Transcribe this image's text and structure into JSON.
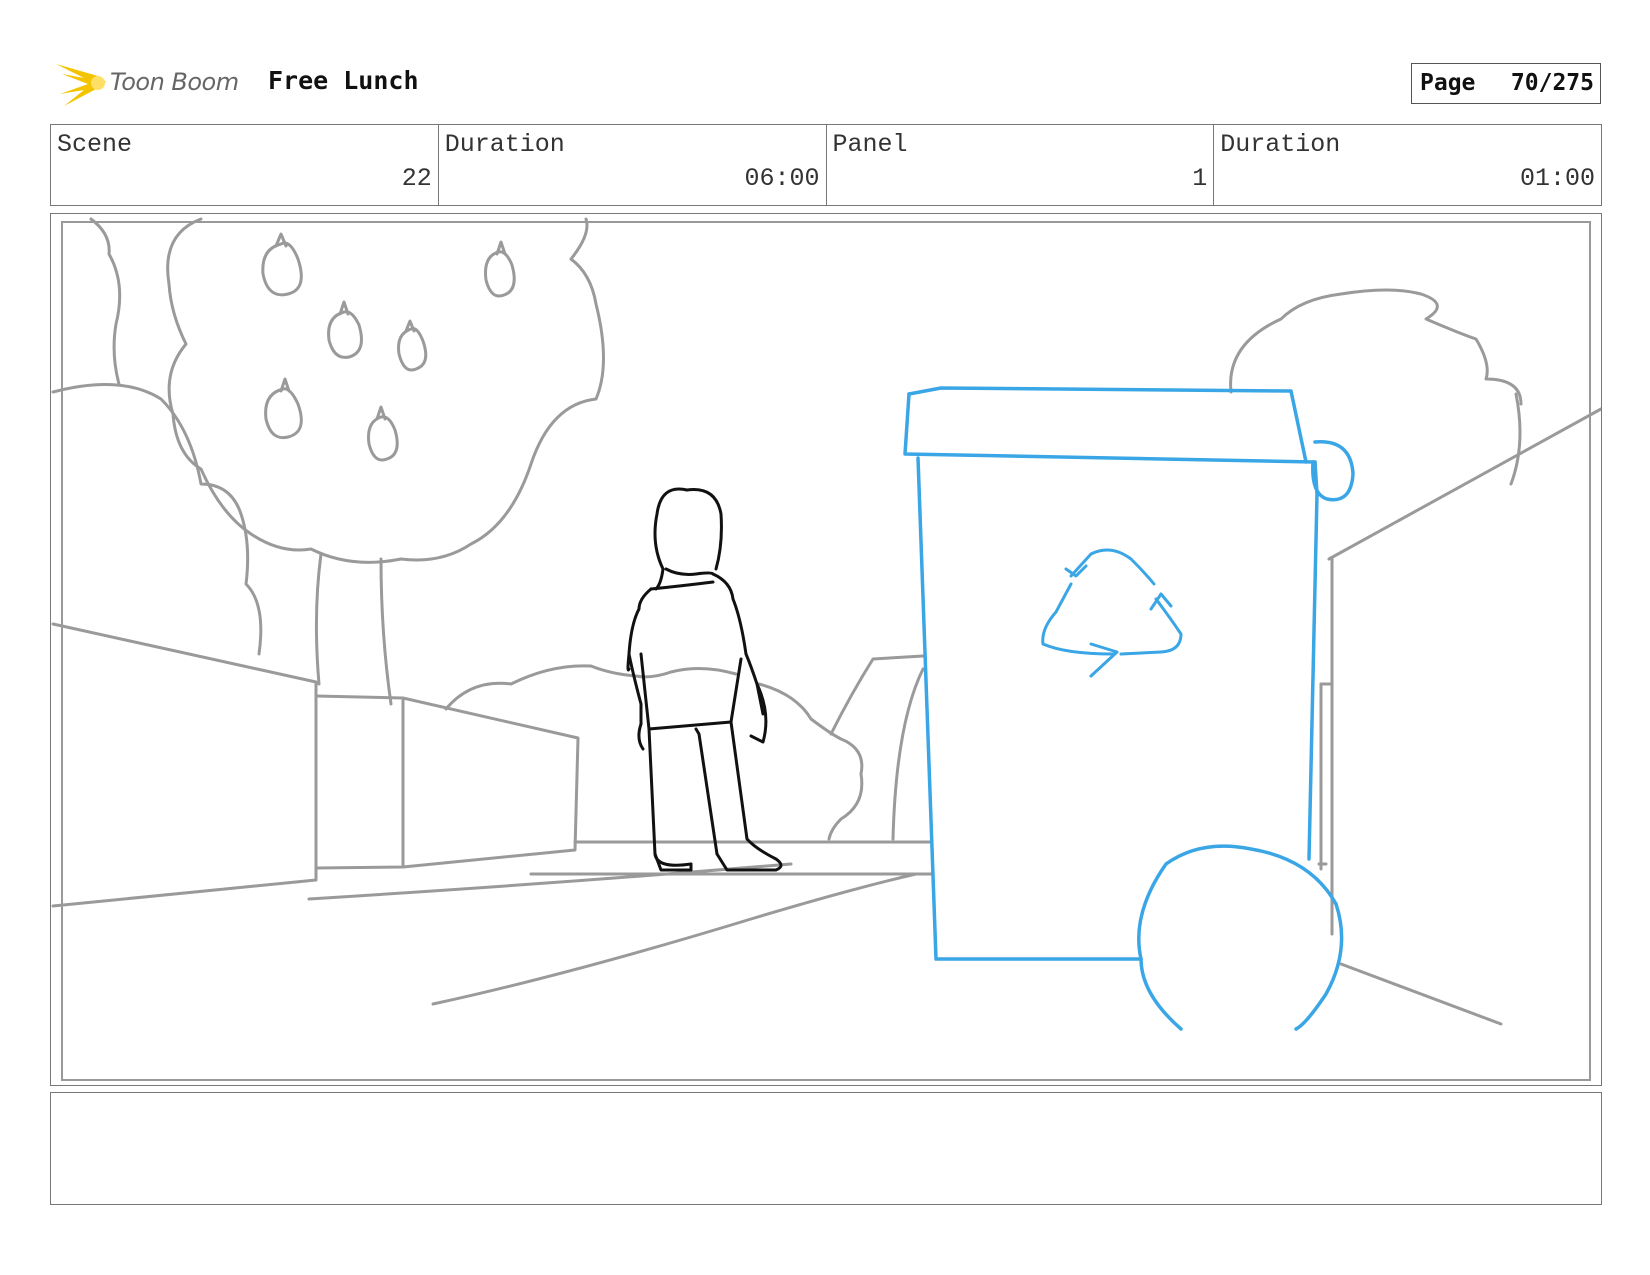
{
  "header": {
    "logo_text": "Toon Boom",
    "project_title": "Free Lunch",
    "page_label": "Page",
    "page_value": "70/275"
  },
  "info": {
    "scene_label": "Scene",
    "scene_value": "22",
    "scene_duration_label": "Duration",
    "scene_duration_value": "06:00",
    "panel_label": "Panel",
    "panel_value": "1",
    "panel_duration_label": "Duration",
    "panel_duration_value": "01:00"
  },
  "colors": {
    "sketch_gray": "#9a9a9a",
    "character_black": "#111111",
    "bin_blue": "#3aa6e6",
    "logo_yellow": "#f5c400"
  },
  "icons": [
    "toon-boom-logo-icon",
    "recycle-icon"
  ],
  "caption": {
    "text": ""
  }
}
